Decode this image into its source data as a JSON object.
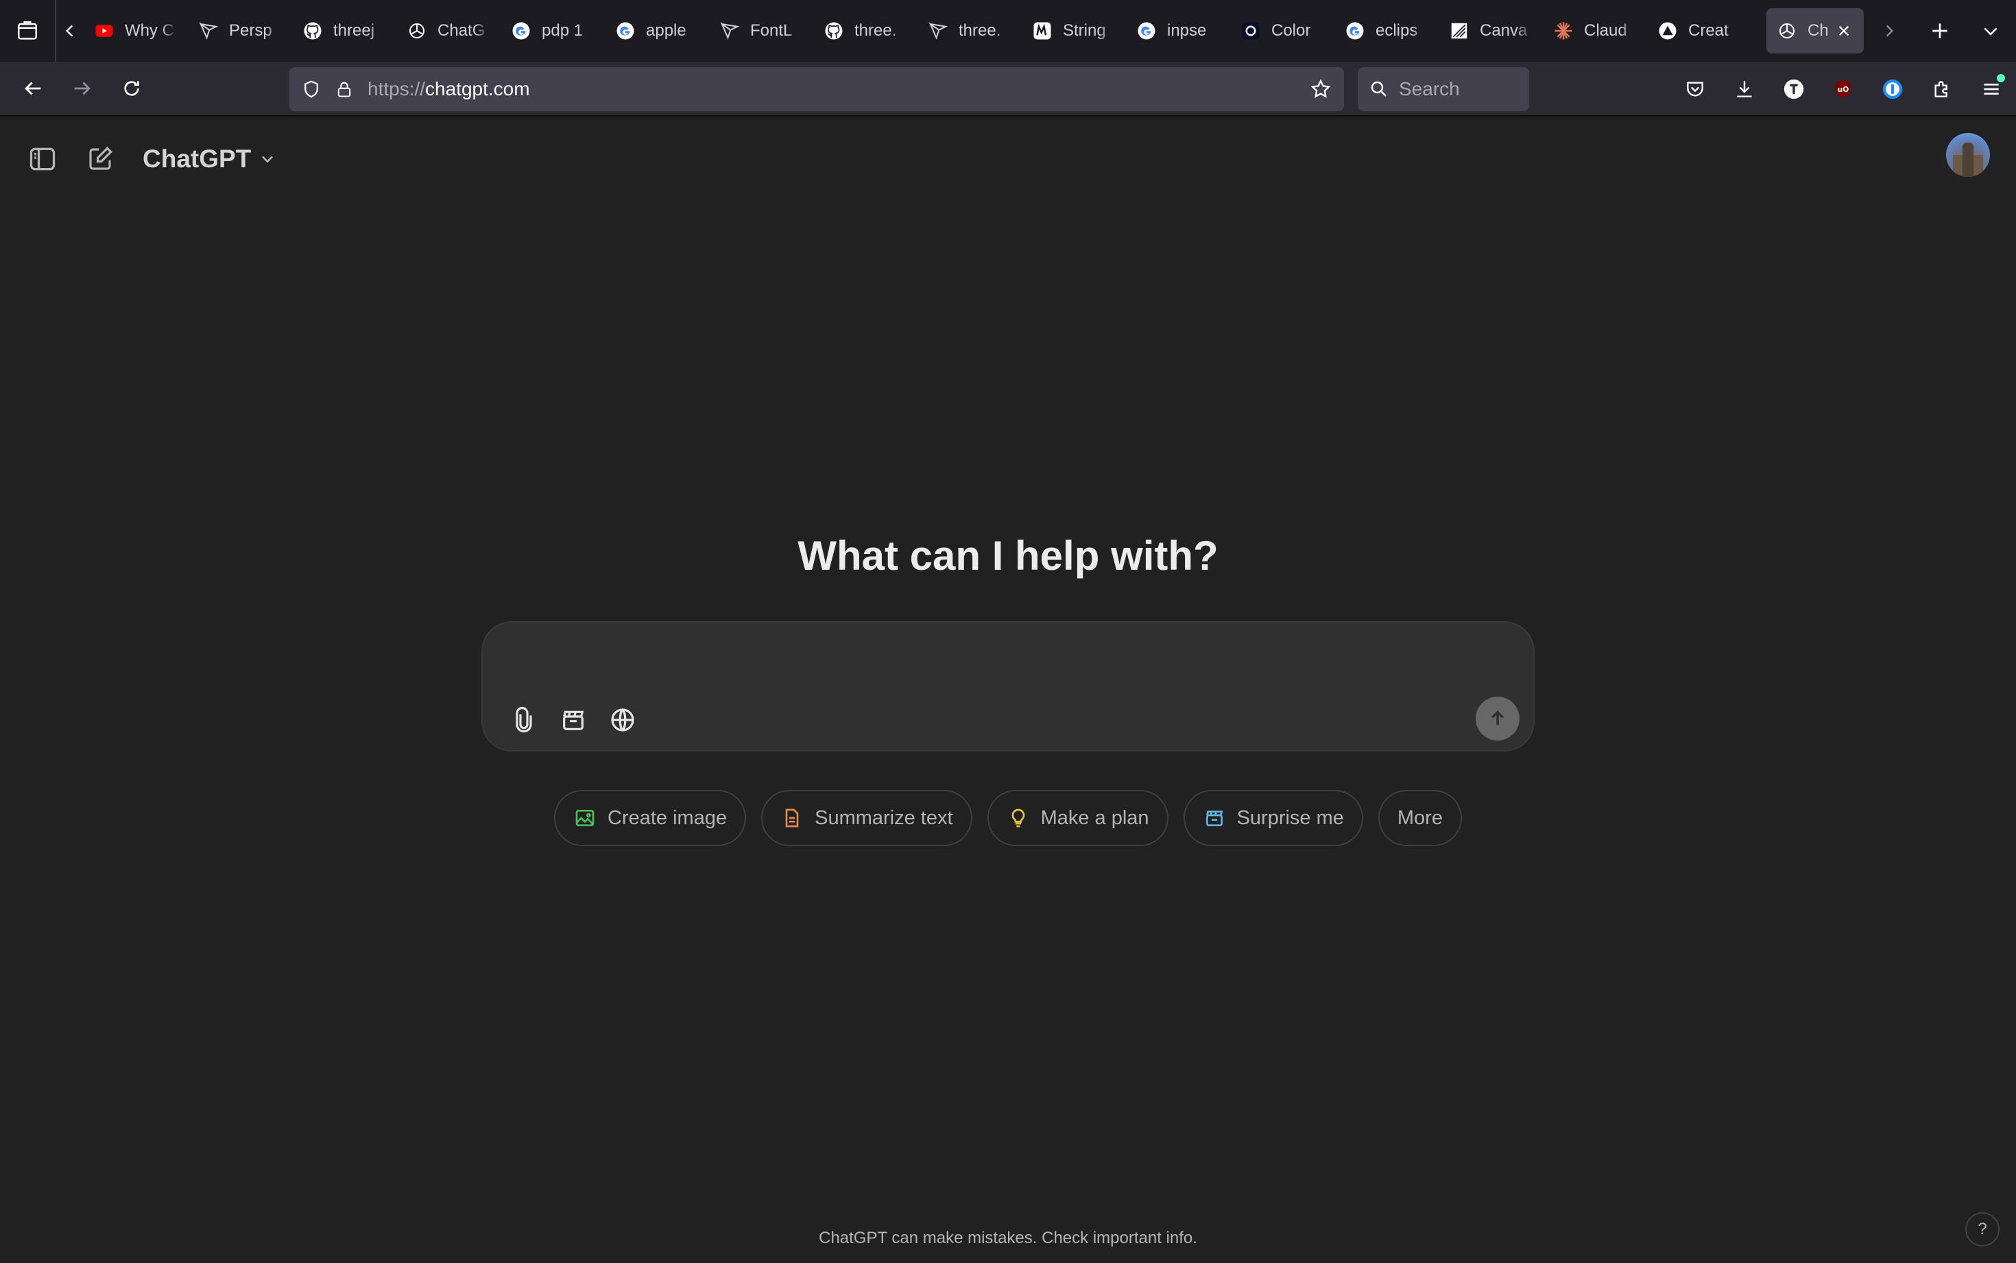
{
  "browser": {
    "tabs": [
      {
        "label": "Why C",
        "icon": "youtube-icon"
      },
      {
        "label": "Persp",
        "icon": "perplexity-icon"
      },
      {
        "label": "threej",
        "icon": "github-icon"
      },
      {
        "label": "ChatG",
        "icon": "openai-icon"
      },
      {
        "label": "pdp 1",
        "icon": "google-icon"
      },
      {
        "label": "apple",
        "icon": "google-icon"
      },
      {
        "label": "FontL",
        "icon": "perplexity-icon"
      },
      {
        "label": "three.",
        "icon": "github-icon"
      },
      {
        "label": "three.",
        "icon": "perplexity-icon"
      },
      {
        "label": "String",
        "icon": "m-logo-icon"
      },
      {
        "label": "inpse",
        "icon": "google-icon"
      },
      {
        "label": "Color",
        "icon": "color-app-icon"
      },
      {
        "label": "eclips",
        "icon": "google-icon"
      },
      {
        "label": "Canva",
        "icon": "canvas-icon"
      },
      {
        "label": "Claud",
        "icon": "claude-icon"
      },
      {
        "label": "Creat",
        "icon": "triangle-logo-icon"
      }
    ],
    "active_tab": {
      "label": "Ch",
      "icon": "openai-icon"
    },
    "url": {
      "protocol": "https://",
      "host": "chatgpt.com"
    },
    "search_placeholder": "Search"
  },
  "app": {
    "model_name": "ChatGPT",
    "headline": "What can I help with?",
    "composer_placeholder": "",
    "chips": [
      {
        "label": "Create image",
        "icon": "image-icon",
        "color": "#4bbd5b"
      },
      {
        "label": "Summarize text",
        "icon": "document-icon",
        "color": "#e2884b"
      },
      {
        "label": "Make a plan",
        "icon": "lightbulb-icon",
        "color": "#e3c342"
      },
      {
        "label": "Surprise me",
        "icon": "gift-icon",
        "color": "#5fb7e6"
      },
      {
        "label": "More",
        "icon": "",
        "color": ""
      }
    ],
    "disclaimer": "ChatGPT can make mistakes. Check important info.",
    "help_label": "?"
  },
  "colors": {
    "page_bg": "#212121",
    "composer_bg": "#303030",
    "chrome_bg": "#1c1b22",
    "toolbar_bg": "#2b2a33"
  }
}
